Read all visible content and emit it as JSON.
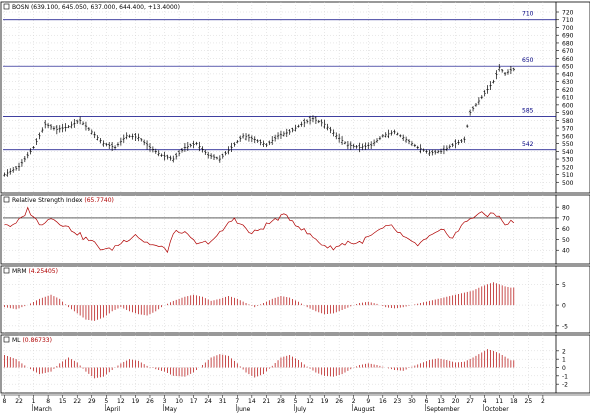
{
  "chart_data": [
    {
      "type": "bar",
      "name_label": "BOSN",
      "header_values": "(639.100, 645.050, 637.000, 644.400, +13.4000)",
      "yaxis": {
        "min": 490,
        "max": 720,
        "ticks": [
          500,
          510,
          520,
          530,
          540,
          550,
          560,
          570,
          580,
          590,
          600,
          610,
          620,
          630,
          640,
          650,
          660,
          670,
          680,
          690,
          700,
          710,
          720
        ]
      },
      "hlines": [
        {
          "value": 710,
          "label": "710"
        },
        {
          "value": 650,
          "label": "650"
        },
        {
          "value": 585,
          "label": "585"
        },
        {
          "value": 542,
          "label": "542"
        }
      ],
      "close_anchors": [
        [
          0,
          510
        ],
        [
          5,
          520
        ],
        [
          10,
          545
        ],
        [
          14,
          575
        ],
        [
          18,
          568
        ],
        [
          22,
          572
        ],
        [
          26,
          580
        ],
        [
          30,
          565
        ],
        [
          34,
          550
        ],
        [
          38,
          545
        ],
        [
          42,
          560
        ],
        [
          46,
          558
        ],
        [
          50,
          545
        ],
        [
          54,
          535
        ],
        [
          58,
          530
        ],
        [
          62,
          545
        ],
        [
          66,
          550
        ],
        [
          70,
          535
        ],
        [
          74,
          530
        ],
        [
          78,
          545
        ],
        [
          82,
          560
        ],
        [
          86,
          555
        ],
        [
          90,
          548
        ],
        [
          94,
          560
        ],
        [
          98,
          565
        ],
        [
          102,
          575
        ],
        [
          106,
          582
        ],
        [
          110,
          575
        ],
        [
          114,
          560
        ],
        [
          118,
          548
        ],
        [
          122,
          545
        ],
        [
          126,
          548
        ],
        [
          130,
          560
        ],
        [
          134,
          565
        ],
        [
          138,
          555
        ],
        [
          142,
          545
        ],
        [
          146,
          538
        ],
        [
          150,
          540
        ],
        [
          154,
          548
        ],
        [
          158,
          555
        ],
        [
          160,
          590
        ],
        [
          164,
          610
        ],
        [
          166,
          620
        ],
        [
          168,
          630
        ],
        [
          170,
          648
        ],
        [
          172,
          640
        ],
        [
          174,
          645
        ]
      ]
    },
    {
      "type": "line",
      "name_label": "Relative Strength Index",
      "header_values": "(65.7740)",
      "yaxis": {
        "min": 30,
        "max": 82,
        "ticks": [
          40,
          50,
          60,
          70,
          80
        ]
      },
      "hlines": [
        {
          "value": 70,
          "label": ""
        }
      ],
      "anchors": [
        [
          0,
          65
        ],
        [
          3,
          62
        ],
        [
          6,
          70
        ],
        [
          8,
          78
        ],
        [
          10,
          72
        ],
        [
          12,
          63
        ],
        [
          15,
          70
        ],
        [
          18,
          68
        ],
        [
          21,
          62
        ],
        [
          24,
          58
        ],
        [
          27,
          52
        ],
        [
          30,
          48
        ],
        [
          33,
          42
        ],
        [
          36,
          40
        ],
        [
          39,
          45
        ],
        [
          42,
          50
        ],
        [
          45,
          55
        ],
        [
          48,
          48
        ],
        [
          51,
          45
        ],
        [
          54,
          42
        ],
        [
          56,
          40
        ],
        [
          58,
          55
        ],
        [
          61,
          58
        ],
        [
          64,
          50
        ],
        [
          67,
          45
        ],
        [
          70,
          48
        ],
        [
          73,
          52
        ],
        [
          76,
          62
        ],
        [
          79,
          70
        ],
        [
          82,
          62
        ],
        [
          85,
          55
        ],
        [
          88,
          60
        ],
        [
          91,
          65
        ],
        [
          94,
          70
        ],
        [
          97,
          72
        ],
        [
          100,
          65
        ],
        [
          103,
          58
        ],
        [
          106,
          52
        ],
        [
          109,
          46
        ],
        [
          112,
          42
        ],
        [
          115,
          44
        ],
        [
          118,
          48
        ],
        [
          121,
          46
        ],
        [
          124,
          50
        ],
        [
          127,
          55
        ],
        [
          130,
          60
        ],
        [
          133,
          62
        ],
        [
          136,
          55
        ],
        [
          139,
          48
        ],
        [
          142,
          45
        ],
        [
          145,
          50
        ],
        [
          148,
          55
        ],
        [
          151,
          58
        ],
        [
          154,
          52
        ],
        [
          157,
          62
        ],
        [
          160,
          70
        ],
        [
          163,
          74
        ],
        [
          166,
          72
        ],
        [
          168,
          76
        ],
        [
          170,
          70
        ],
        [
          172,
          64
        ],
        [
          174,
          66
        ]
      ],
      "series_color": "#b00000"
    },
    {
      "type": "bar",
      "name_label": "MRM",
      "header_values": "(4.25405)",
      "yaxis": {
        "min": -6,
        "max": 7,
        "ticks": [
          -5,
          0,
          5
        ]
      },
      "anchors": [
        [
          0,
          -0.5
        ],
        [
          4,
          -1
        ],
        [
          8,
          0
        ],
        [
          12,
          1.5
        ],
        [
          16,
          2.5
        ],
        [
          19,
          1.5
        ],
        [
          22,
          -0.5
        ],
        [
          25,
          -2
        ],
        [
          28,
          -3.5
        ],
        [
          31,
          -3.8
        ],
        [
          34,
          -3
        ],
        [
          37,
          -1.5
        ],
        [
          40,
          -0.5
        ],
        [
          43,
          -1.5
        ],
        [
          46,
          -2.2
        ],
        [
          49,
          -2.5
        ],
        [
          52,
          -1.5
        ],
        [
          55,
          0
        ],
        [
          58,
          1
        ],
        [
          62,
          2
        ],
        [
          65,
          2.5
        ],
        [
          68,
          2
        ],
        [
          71,
          1
        ],
        [
          74,
          1.5
        ],
        [
          77,
          2.2
        ],
        [
          80,
          1.5
        ],
        [
          83,
          0.5
        ],
        [
          86,
          -0.5
        ],
        [
          89,
          0.5
        ],
        [
          92,
          1.5
        ],
        [
          95,
          2.2
        ],
        [
          98,
          1.8
        ],
        [
          101,
          0.8
        ],
        [
          104,
          -0.5
        ],
        [
          107,
          -1.5
        ],
        [
          110,
          -2.2
        ],
        [
          113,
          -2
        ],
        [
          116,
          -1.2
        ],
        [
          119,
          -0.3
        ],
        [
          122,
          0.5
        ],
        [
          125,
          0.8
        ],
        [
          128,
          0.3
        ],
        [
          131,
          -0.5
        ],
        [
          134,
          -0.8
        ],
        [
          137,
          -0.5
        ],
        [
          140,
          0
        ],
        [
          143,
          0.5
        ],
        [
          146,
          1
        ],
        [
          149,
          1.5
        ],
        [
          152,
          2
        ],
        [
          155,
          2.5
        ],
        [
          158,
          3
        ],
        [
          161,
          3.5
        ],
        [
          164,
          4.5
        ],
        [
          166,
          5
        ],
        [
          168,
          5.5
        ],
        [
          170,
          5
        ],
        [
          172,
          4.5
        ],
        [
          174,
          4.2
        ]
      ],
      "series_color": "#b00000"
    },
    {
      "type": "bar",
      "name_label": "ML",
      "header_values": "(0.86733)",
      "yaxis": {
        "min": -2.7,
        "max": 2.7,
        "ticks": [
          -2,
          -1,
          0,
          1,
          2
        ]
      },
      "anchors": [
        [
          0,
          1.5
        ],
        [
          4,
          1
        ],
        [
          8,
          0
        ],
        [
          12,
          -0.8
        ],
        [
          16,
          -0.5
        ],
        [
          19,
          0.5
        ],
        [
          22,
          1.2
        ],
        [
          25,
          0.6
        ],
        [
          28,
          -0.5
        ],
        [
          31,
          -1.3
        ],
        [
          34,
          -1.1
        ],
        [
          37,
          -0.3
        ],
        [
          40,
          0.5
        ],
        [
          43,
          1
        ],
        [
          46,
          0.8
        ],
        [
          49,
          0.2
        ],
        [
          52,
          -0.2
        ],
        [
          55,
          -0.5
        ],
        [
          58,
          -1
        ],
        [
          62,
          -1.1
        ],
        [
          65,
          -0.6
        ],
        [
          68,
          0.3
        ],
        [
          71,
          1.2
        ],
        [
          74,
          1.6
        ],
        [
          77,
          1.4
        ],
        [
          80,
          0.5
        ],
        [
          83,
          -0.6
        ],
        [
          86,
          -1.2
        ],
        [
          89,
          -0.8
        ],
        [
          92,
          0.2
        ],
        [
          95,
          1.2
        ],
        [
          98,
          1.5
        ],
        [
          101,
          0.9
        ],
        [
          104,
          0.1
        ],
        [
          107,
          -0.6
        ],
        [
          110,
          -1
        ],
        [
          113,
          -1.1
        ],
        [
          116,
          -0.8
        ],
        [
          119,
          -0.2
        ],
        [
          122,
          0.3
        ],
        [
          125,
          0.5
        ],
        [
          128,
          0.3
        ],
        [
          131,
          0
        ],
        [
          134,
          -0.3
        ],
        [
          137,
          -0.4
        ],
        [
          140,
          0.1
        ],
        [
          143,
          0.5
        ],
        [
          146,
          0.9
        ],
        [
          149,
          1.1
        ],
        [
          152,
          0.9
        ],
        [
          155,
          0.6
        ],
        [
          158,
          0.7
        ],
        [
          161,
          1.2
        ],
        [
          164,
          1.8
        ],
        [
          166,
          2.2
        ],
        [
          168,
          2
        ],
        [
          170,
          1.7
        ],
        [
          172,
          1.3
        ],
        [
          174,
          0.87
        ]
      ],
      "series_color": "#b00000"
    }
  ],
  "x_axis": {
    "day_ticks": [
      {
        "i": 0,
        "label": "8"
      },
      {
        "i": 5,
        "label": "22"
      },
      {
        "i": 10,
        "label": "1"
      },
      {
        "i": 15,
        "label": "8"
      },
      {
        "i": 20,
        "label": "15"
      },
      {
        "i": 25,
        "label": "22"
      },
      {
        "i": 30,
        "label": "29"
      },
      {
        "i": 35,
        "label": "5"
      },
      {
        "i": 40,
        "label": "12"
      },
      {
        "i": 45,
        "label": "19"
      },
      {
        "i": 50,
        "label": "26"
      },
      {
        "i": 55,
        "label": "3"
      },
      {
        "i": 60,
        "label": "10"
      },
      {
        "i": 65,
        "label": "17"
      },
      {
        "i": 70,
        "label": "24"
      },
      {
        "i": 75,
        "label": "31"
      },
      {
        "i": 80,
        "label": "7"
      },
      {
        "i": 85,
        "label": "14"
      },
      {
        "i": 90,
        "label": "21"
      },
      {
        "i": 95,
        "label": "28"
      },
      {
        "i": 100,
        "label": "5"
      },
      {
        "i": 105,
        "label": "12"
      },
      {
        "i": 110,
        "label": "19"
      },
      {
        "i": 115,
        "label": "26"
      },
      {
        "i": 120,
        "label": "2"
      },
      {
        "i": 125,
        "label": "9"
      },
      {
        "i": 130,
        "label": "16"
      },
      {
        "i": 135,
        "label": "23"
      },
      {
        "i": 140,
        "label": "30"
      },
      {
        "i": 145,
        "label": "6"
      },
      {
        "i": 150,
        "label": "13"
      },
      {
        "i": 155,
        "label": "20"
      },
      {
        "i": 160,
        "label": "27"
      },
      {
        "i": 165,
        "label": "4"
      },
      {
        "i": 170,
        "label": "11"
      },
      {
        "i": 175,
        "label": "18"
      },
      {
        "i": 180,
        "label": "25"
      },
      {
        "i": 185,
        "label": "2"
      }
    ],
    "months": [
      {
        "i": 10,
        "label": "March"
      },
      {
        "i": 35,
        "label": "April"
      },
      {
        "i": 55,
        "label": "May"
      },
      {
        "i": 80,
        "label": "June"
      },
      {
        "i": 100,
        "label": "July"
      },
      {
        "i": 120,
        "label": "August"
      },
      {
        "i": 145,
        "label": "September"
      },
      {
        "i": 165,
        "label": "October"
      }
    ],
    "n_bars": 176,
    "n_slots": 190
  },
  "colors": {
    "grid": "#d0d0d0",
    "bars": "#000000",
    "line": "#b00000",
    "hline": "#000080",
    "label": "#000080",
    "header_val": "#b00000"
  }
}
